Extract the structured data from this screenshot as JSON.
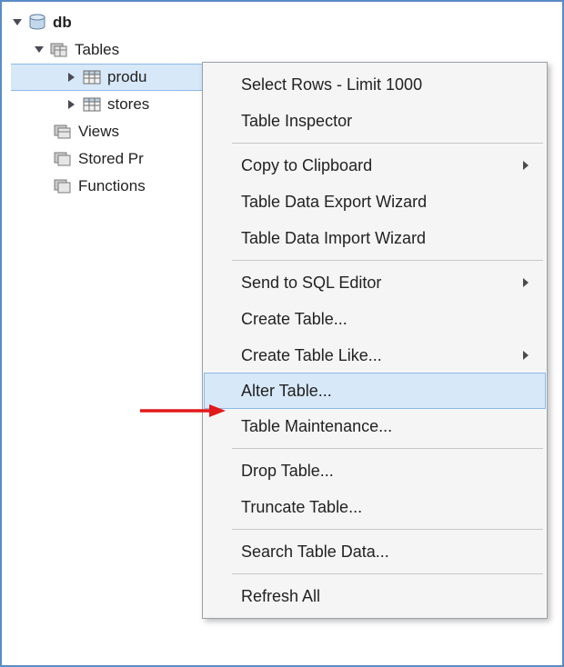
{
  "tree": {
    "db": "db",
    "tables_label": "Tables",
    "table1": "produ",
    "table2": "stores",
    "views": "Views",
    "stored_procs": "Stored Pr",
    "functions": "Functions"
  },
  "menu": {
    "select_rows": "Select Rows - Limit 1000",
    "table_inspector": "Table Inspector",
    "copy_clipboard": "Copy to Clipboard",
    "export": "Table Data Export Wizard",
    "import": "Table Data Import Wizard",
    "send_sql": "Send to SQL Editor",
    "create_table": "Create Table...",
    "create_table_like": "Create Table Like...",
    "alter_table": "Alter Table...",
    "maintenance": "Table Maintenance...",
    "drop_table": "Drop Table...",
    "truncate": "Truncate Table...",
    "search": "Search Table Data...",
    "refresh": "Refresh All"
  }
}
